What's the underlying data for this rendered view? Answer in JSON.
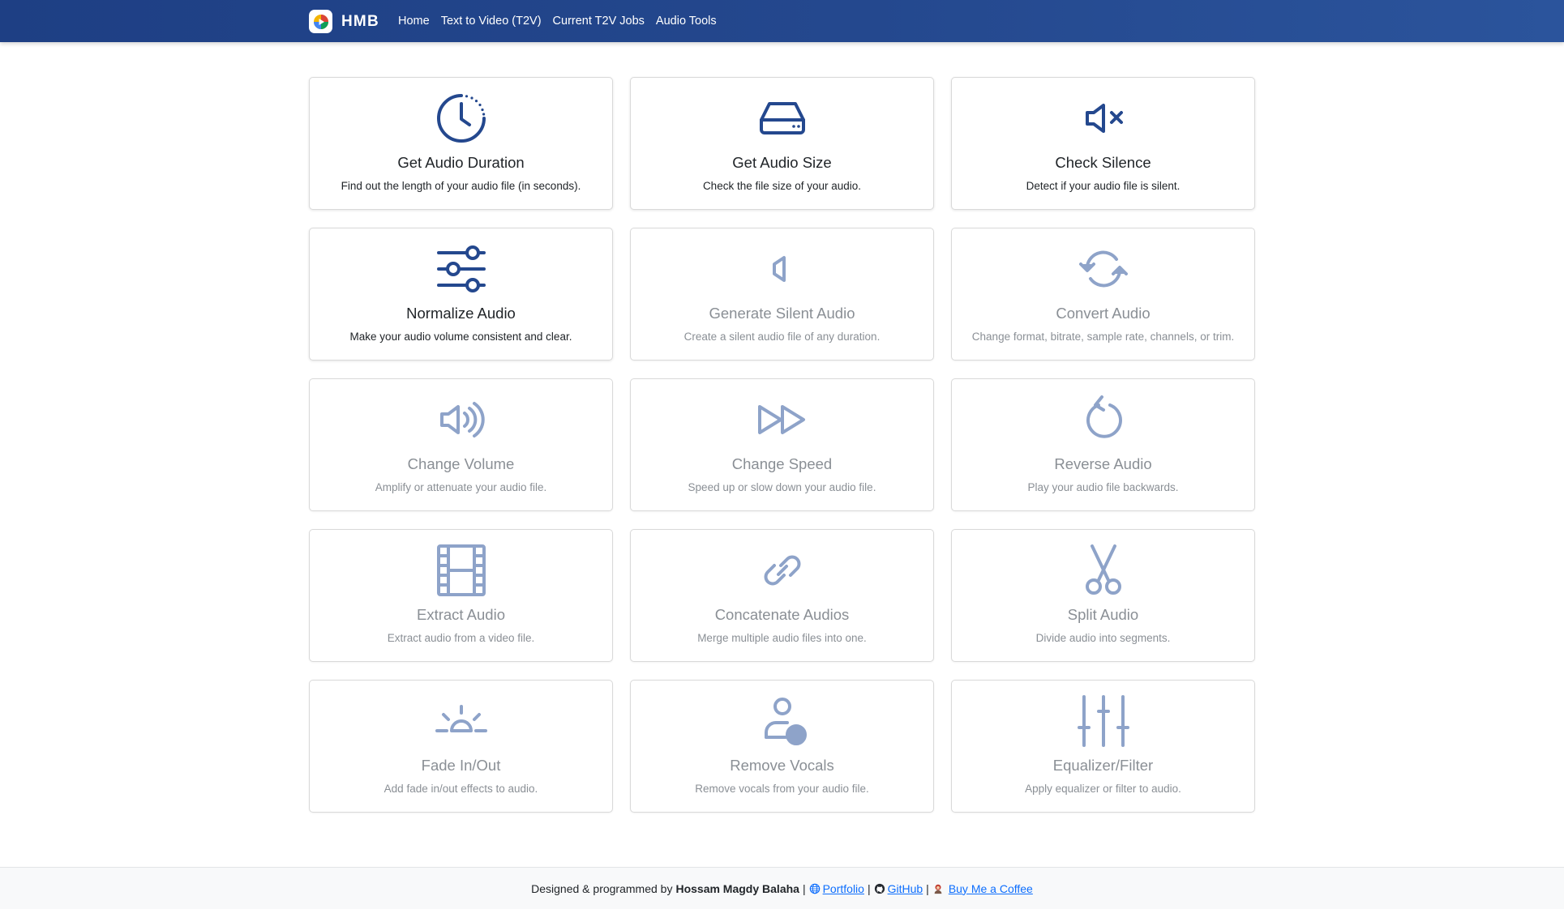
{
  "header": {
    "brand": "HMB",
    "nav": [
      "Home",
      "Text to Video (T2V)",
      "Current T2V Jobs",
      "Audio Tools"
    ]
  },
  "colors": {
    "navbar": "#24488e",
    "accent_icon": "#24488e",
    "muted_icon": "#8ea3c9",
    "link": "#0d6efd"
  },
  "tools": [
    {
      "title": "Get Audio Duration",
      "desc": "Find out the length of your audio file (in seconds).",
      "icon": "clock-icon",
      "enabled": true
    },
    {
      "title": "Get Audio Size",
      "desc": "Check the file size of your audio.",
      "icon": "hard-drive-icon",
      "enabled": true
    },
    {
      "title": "Check Silence",
      "desc": "Detect if your audio file is silent.",
      "icon": "volume-mute-icon",
      "enabled": true
    },
    {
      "title": "Normalize Audio",
      "desc": "Make your audio volume consistent and clear.",
      "icon": "sliders-icon",
      "enabled": true
    },
    {
      "title": "Generate Silent Audio",
      "desc": "Create a silent audio file of any duration.",
      "icon": "speaker-off-icon",
      "enabled": false
    },
    {
      "title": "Convert Audio",
      "desc": "Change format, bitrate, sample rate, channels, or trim.",
      "icon": "refresh-icon",
      "enabled": false
    },
    {
      "title": "Change Volume",
      "desc": "Amplify or attenuate your audio file.",
      "icon": "volume-up-icon",
      "enabled": false
    },
    {
      "title": "Change Speed",
      "desc": "Speed up or slow down your audio file.",
      "icon": "fast-forward-icon",
      "enabled": false
    },
    {
      "title": "Reverse Audio",
      "desc": "Play your audio file backwards.",
      "icon": "rotate-left-icon",
      "enabled": false
    },
    {
      "title": "Extract Audio",
      "desc": "Extract audio from a video file.",
      "icon": "film-icon",
      "enabled": false
    },
    {
      "title": "Concatenate Audios",
      "desc": "Merge multiple audio files into one.",
      "icon": "link-icon",
      "enabled": false
    },
    {
      "title": "Split Audio",
      "desc": "Divide audio into segments.",
      "icon": "scissors-icon",
      "enabled": false
    },
    {
      "title": "Fade In/Out",
      "desc": "Add fade in/out effects to audio.",
      "icon": "sunrise-icon",
      "enabled": false
    },
    {
      "title": "Remove Vocals",
      "desc": "Remove vocals from your audio file.",
      "icon": "person-icon",
      "enabled": false
    },
    {
      "title": "Equalizer/Filter",
      "desc": "Apply equalizer or filter to audio.",
      "icon": "equalizer-icon",
      "enabled": false
    }
  ],
  "footer": {
    "prefix": "Designed & programmed by",
    "author": "Hossam Magdy Balaha",
    "sep": "|",
    "portfolio": "Portfolio",
    "github": "GitHub",
    "coffee": "Buy Me a Coffee"
  }
}
